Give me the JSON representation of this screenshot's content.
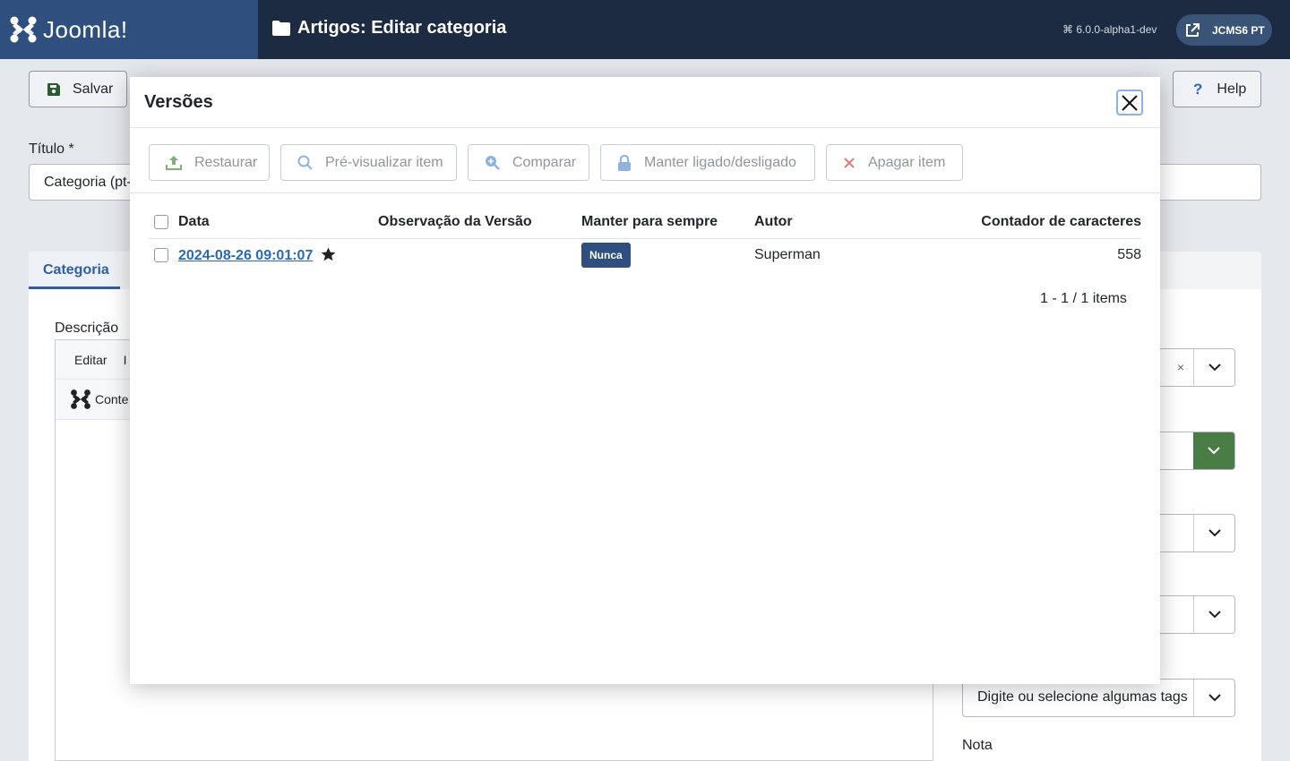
{
  "header": {
    "brand": "Joomla!",
    "page_title": "Artigos: Editar categoria",
    "version": "6.0.0-alpha1-dev",
    "site_button": "JCMS6 PT"
  },
  "toolbar": {
    "save_label": "Salvar",
    "help_label": "Help"
  },
  "form": {
    "title_label": "Título *",
    "title_value": "Categoria (pt-",
    "tab_category": "Categoria",
    "description_label": "Descrição",
    "editor_menu": [
      "Editar",
      "I"
    ],
    "editor_content_button": "Conte",
    "tags_placeholder": "Digite ou selecione algumas tags",
    "note_label": "Nota"
  },
  "modal": {
    "title": "Versões",
    "actions": {
      "restore": "Restaurar",
      "preview": "Pré-visualizar item",
      "compare": "Comparar",
      "keep": "Manter ligado/desligado",
      "delete": "Apagar item"
    },
    "table": {
      "headers": {
        "date": "Data",
        "note": "Observação da Versão",
        "keep": "Manter para sempre",
        "author": "Autor",
        "chars": "Contador de caracteres"
      },
      "rows": [
        {
          "date": "2024-08-26 09:01:07",
          "note": "",
          "keep": "Nunca",
          "author": "Superman",
          "chars": "558"
        }
      ]
    },
    "pagination": "1 - 1 / 1 items"
  },
  "colors": {
    "header_bg": "#1c2a42",
    "brand_bg": "#2f4f7f",
    "link": "#2a69b8",
    "badge": "#2f4f7f"
  }
}
